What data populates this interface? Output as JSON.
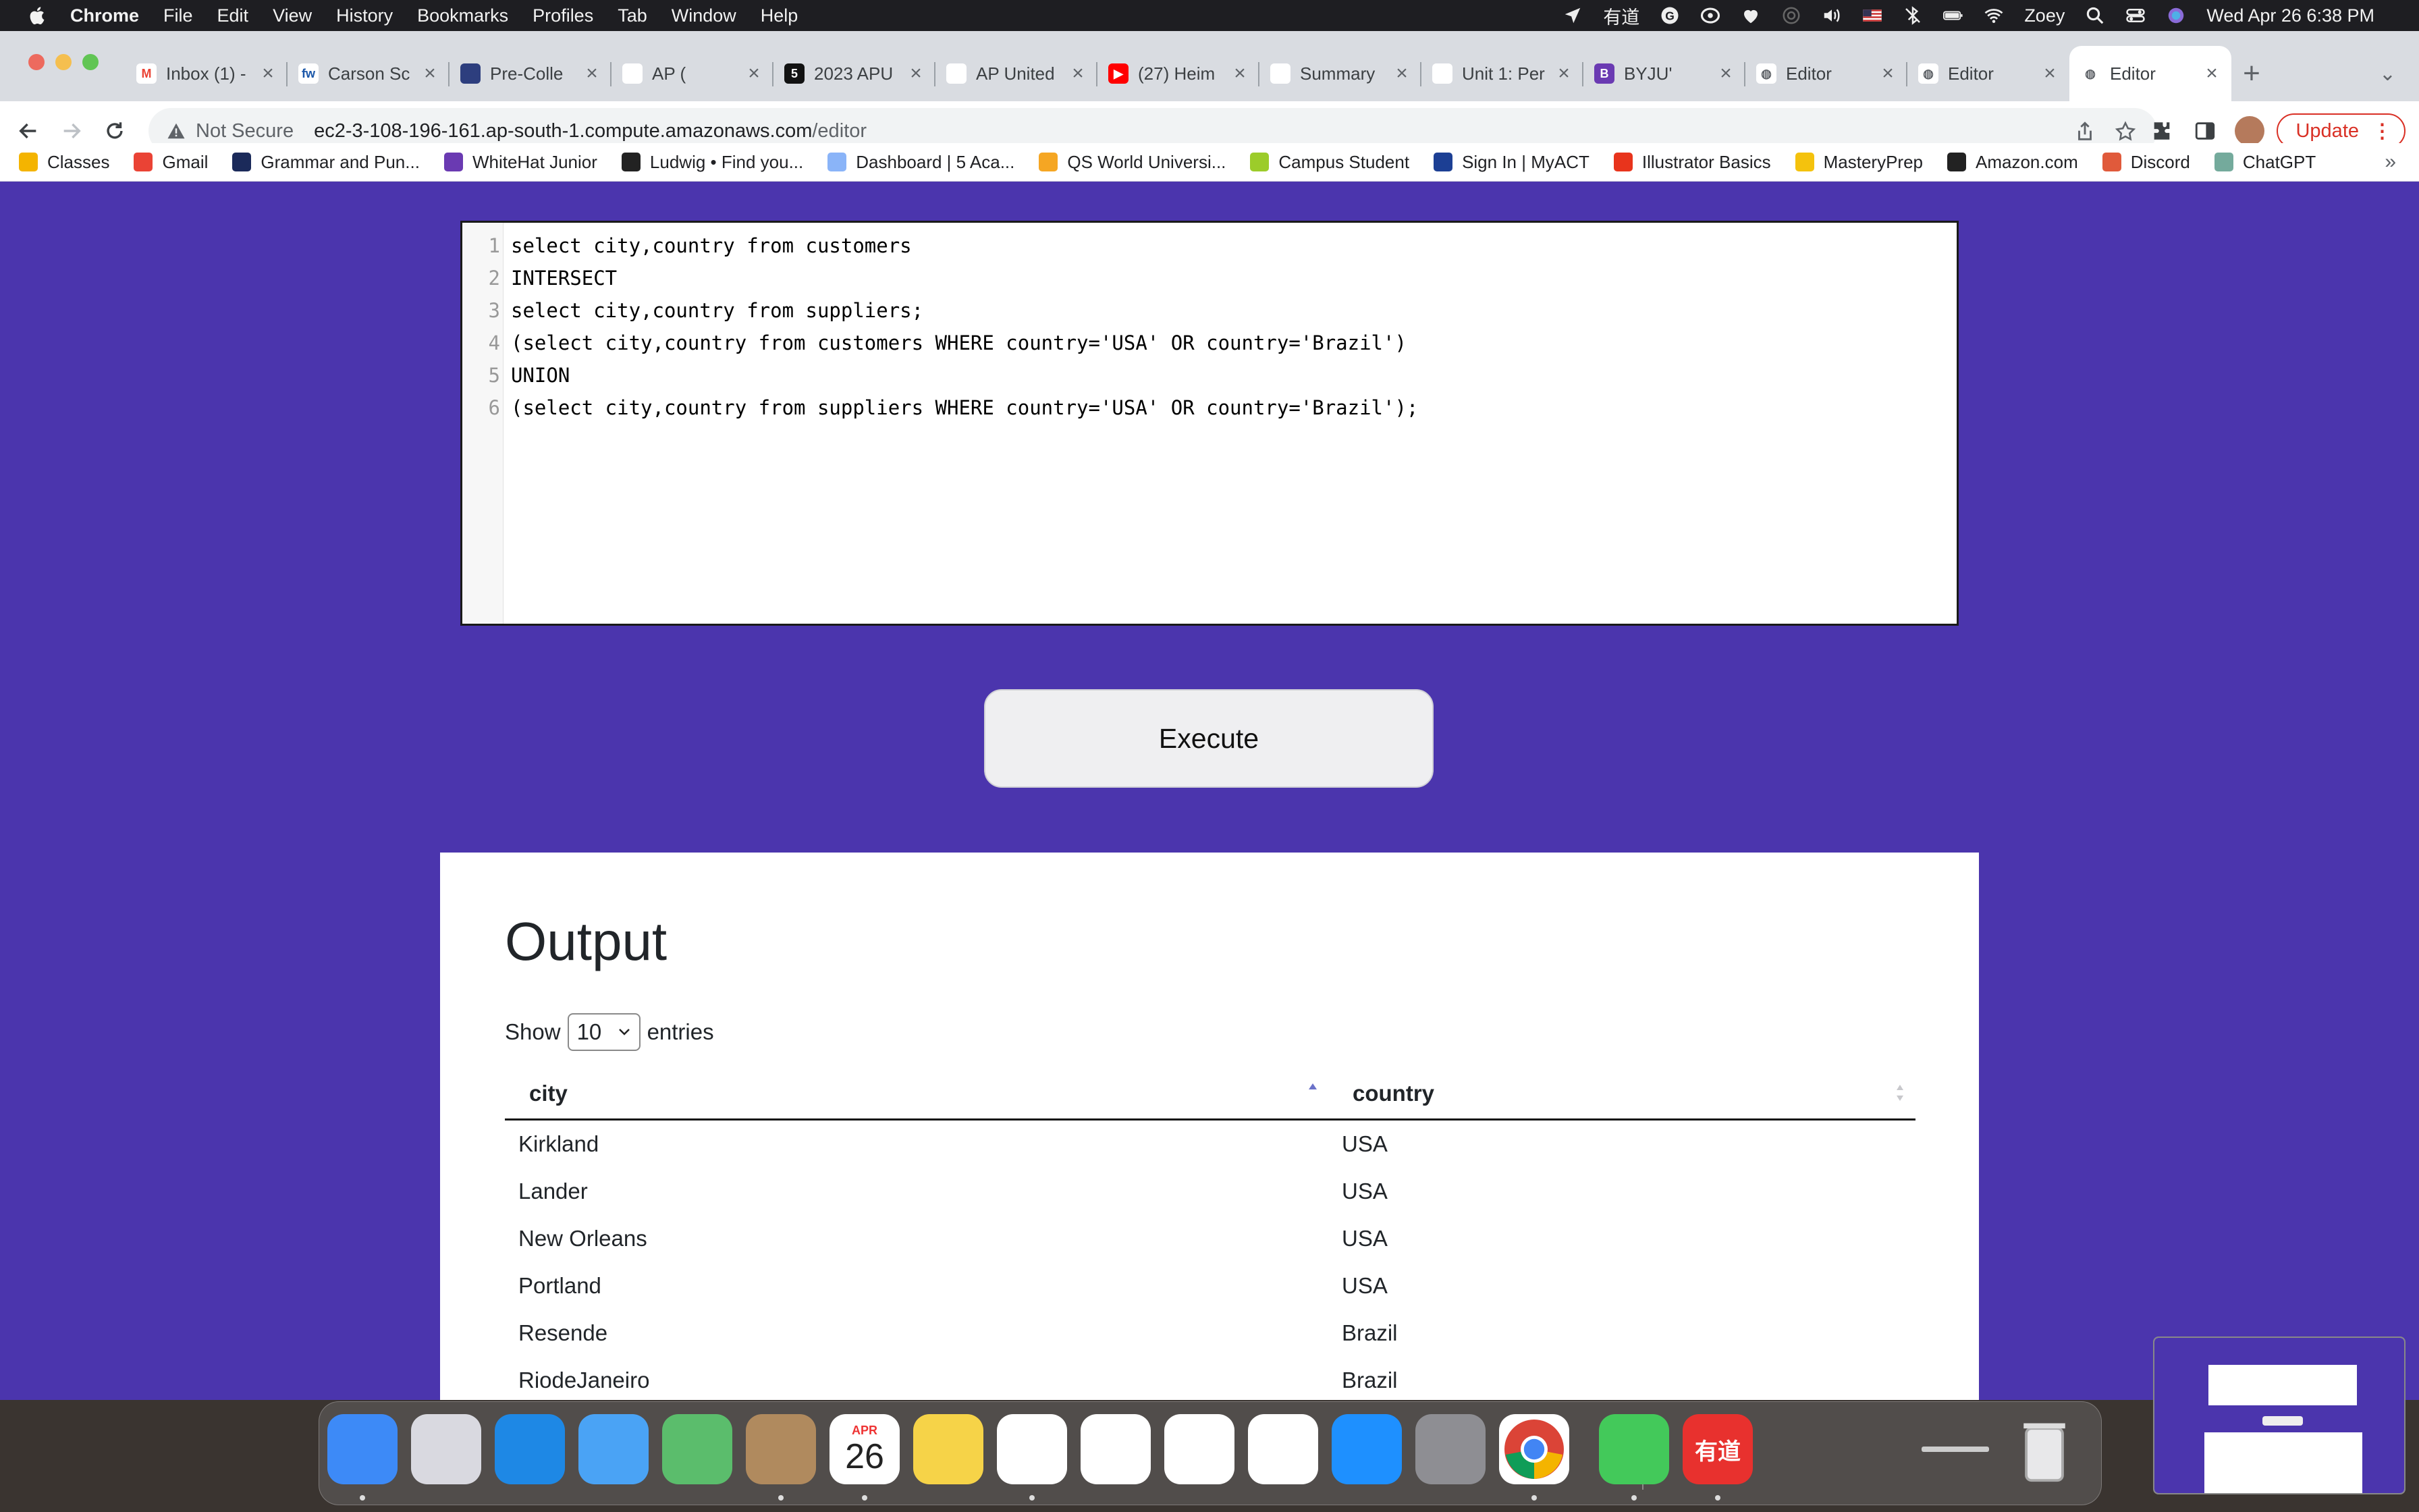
{
  "menubar": {
    "app_name": "Chrome",
    "menus": [
      "File",
      "Edit",
      "View",
      "History",
      "Bookmarks",
      "Profiles",
      "Tab",
      "Window",
      "Help"
    ],
    "youdao_label": "有道",
    "user": "Zoey",
    "datetime": "Wed Apr 26  6:38 PM"
  },
  "tabs": [
    {
      "title": "Inbox (1) -",
      "fav_color": "#ffffff",
      "fav_text": "M",
      "fav_text_color": "#ea4335"
    },
    {
      "title": "Carson Sc",
      "fav_color": "#ffffff",
      "fav_text": "fw",
      "fav_text_color": "#1a56a8"
    },
    {
      "title": "Pre-Colle",
      "fav_color": "#2d3e7e",
      "fav_text": "",
      "fav_text_color": "#ffffff"
    },
    {
      "title": "AP (",
      "fav_color": "#ffffff",
      "fav_text": "",
      "fav_text_color": "#ffffff"
    },
    {
      "title": "2023 APU",
      "fav_color": "#121212",
      "fav_text": "5",
      "fav_text_color": "#ffffff"
    },
    {
      "title": "AP United",
      "fav_color": "#ffffff",
      "fav_text": "",
      "fav_text_color": "#333333"
    },
    {
      "title": "(27) Heim",
      "fav_color": "#ff0000",
      "fav_text": "▶",
      "fav_text_color": "#ffffff"
    },
    {
      "title": "Summary",
      "fav_color": "#ffffff",
      "fav_text": "",
      "fav_text_color": "#7cc3d8"
    },
    {
      "title": "Unit 1: Per",
      "fav_color": "#ffffff",
      "fav_text": "",
      "fav_text_color": "#7cc3d8"
    },
    {
      "title": "BYJU'",
      "fav_color": "#6a3ab2",
      "fav_text": "B",
      "fav_text_color": "#ffffff"
    },
    {
      "title": "Editor",
      "fav_color": "#ffffff",
      "fav_text": "◍",
      "fav_text_color": "#5f6368"
    },
    {
      "title": "Editor",
      "fav_color": "#ffffff",
      "fav_text": "◍",
      "fav_text_color": "#5f6368"
    },
    {
      "title": "Editor",
      "fav_color": "#ffffff",
      "fav_text": "◍",
      "fav_text_color": "#5f6368"
    }
  ],
  "active_tab_index": 12,
  "address": {
    "security_label": "Not Secure",
    "host": "ec2-3-108-196-161.ap-south-1.compute.amazonaws.com",
    "path": "/editor"
  },
  "update_label": "Update",
  "bookmarks": [
    {
      "label": "Classes",
      "color": "#f4b400"
    },
    {
      "label": "Gmail",
      "color": "#ea4335"
    },
    {
      "label": "Grammar and Pun...",
      "color": "#1b2a5a"
    },
    {
      "label": "WhiteHat Junior",
      "color": "#6a3ab2"
    },
    {
      "label": "Ludwig • Find you...",
      "color": "#222222"
    },
    {
      "label": "Dashboard | 5 Aca...",
      "color": "#8ab4f8"
    },
    {
      "label": "QS World Universi...",
      "color": "#f5a623"
    },
    {
      "label": "Campus Student",
      "color": "#9ccc2a"
    },
    {
      "label": "Sign In | MyACT",
      "color": "#1c3f94"
    },
    {
      "label": "Illustrator Basics",
      "color": "#e8341c"
    },
    {
      "label": "MasteryPrep",
      "color": "#f4c20d"
    },
    {
      "label": "Amazon.com",
      "color": "#222222"
    },
    {
      "label": "Discord",
      "color": "#e05a3b"
    },
    {
      "label": "ChatGPT",
      "color": "#74aa9c"
    }
  ],
  "editor": {
    "lines": [
      "select city,country from customers",
      "INTERSECT",
      "select city,country from suppliers;",
      "(select city,country from customers WHERE country='USA' OR country='Brazil')",
      "UNION",
      "(select city,country from suppliers WHERE country='USA' OR country='Brazil');"
    ]
  },
  "execute_label": "Execute",
  "output": {
    "title": "Output",
    "show_label": "Show",
    "entries_value": "10",
    "entries_label": "entries",
    "columns": [
      "city",
      "country"
    ],
    "rows": [
      [
        "Kirkland",
        "USA"
      ],
      [
        "Lander",
        "USA"
      ],
      [
        "New Orleans",
        "USA"
      ],
      [
        "Portland",
        "USA"
      ],
      [
        "Resende",
        "Brazil"
      ],
      [
        "RiodeJaneiro",
        "Brazil"
      ]
    ]
  },
  "dock": {
    "apps": [
      {
        "name": "finder",
        "color": "#3d8af7"
      },
      {
        "name": "launchpad",
        "color": "#d9d9e0"
      },
      {
        "name": "safari",
        "color": "#1e88e5"
      },
      {
        "name": "mail",
        "color": "#4aa3f5"
      },
      {
        "name": "maps",
        "color": "#5bbd6c"
      },
      {
        "name": "contacts",
        "color": "#b08a5e"
      },
      {
        "name": "calendar",
        "color": "#ffffff"
      },
      {
        "name": "notes",
        "color": "#f6d348"
      },
      {
        "name": "news",
        "color": "#ffffff"
      },
      {
        "name": "numbers",
        "color": "#ffffff"
      },
      {
        "name": "keynote",
        "color": "#ffffff"
      },
      {
        "name": "pages",
        "color": "#ffffff"
      },
      {
        "name": "app-store",
        "color": "#1e90ff"
      },
      {
        "name": "system-preferences",
        "color": "#8e8e93"
      },
      {
        "name": "chrome",
        "color": "#ffffff"
      },
      {
        "name": "messages",
        "color": "#43c95a"
      },
      {
        "name": "youdao",
        "color": "#e8312e"
      }
    ],
    "calendar_month": "APR",
    "calendar_day": "26",
    "youdao_label": "有道"
  }
}
